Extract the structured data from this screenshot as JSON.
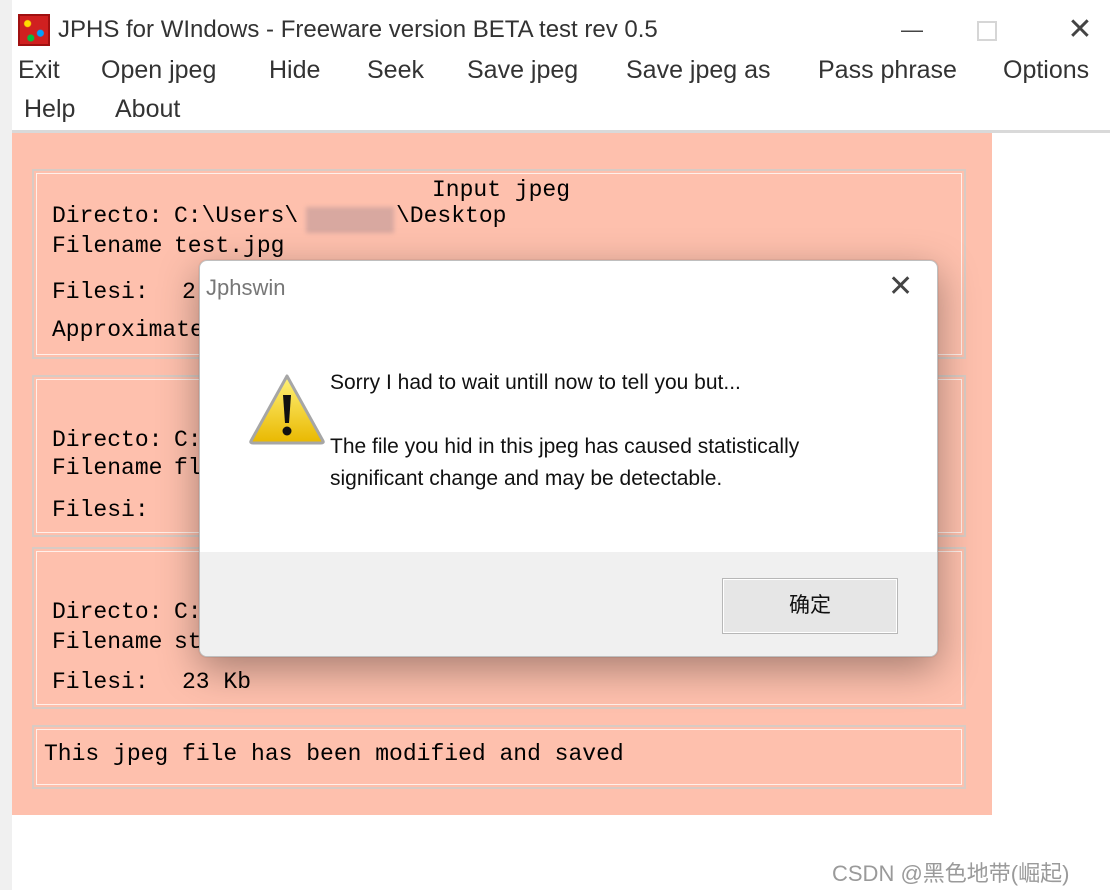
{
  "window": {
    "title": "JPHS for WIndows - Freeware version BETA test rev 0.5",
    "minimize": "—",
    "close": "✕"
  },
  "menu": {
    "exit": "Exit",
    "open_jpeg": "Open jpeg",
    "hide": "Hide",
    "seek": "Seek",
    "save_jpeg": "Save jpeg",
    "save_jpeg_as": "Save jpeg as",
    "pass_phrase": "Pass phrase",
    "options": "Options",
    "help": "Help",
    "about": "About"
  },
  "input_panel": {
    "header": "Input jpeg",
    "directory_label": "Directo:",
    "directory_prefix": "C:\\Users\\",
    "directory_suffix": "\\Desktop",
    "filename_label": "Filename",
    "filename_value": "test.jpg",
    "filesize_label": "Filesi:",
    "filesize_value": "2",
    "approx_label": "Approximate"
  },
  "hidden_panel": {
    "directory_label": "Directo:",
    "directory_value": "C:",
    "filename_label": "Filename",
    "filename_value": "fl",
    "filesize_label": "Filesi:"
  },
  "saved_panel": {
    "directory_label": "Directo:",
    "directory_value": "C:",
    "filename_label": "Filename",
    "filename_value": "st",
    "filesize_label": "Filesi:",
    "filesize_value": "23 Kb"
  },
  "status": {
    "text": "This jpeg file has been modified and saved"
  },
  "dialog": {
    "title": "Jphswin",
    "close": "✕",
    "line1": "Sorry I had to wait untill now to tell you but...",
    "line2": "The file you hid in this jpeg has caused statistically",
    "line3": "significant change and may be detectable.",
    "ok": "确定",
    "icon": "warning-icon"
  },
  "watermark": "CSDN @黑色地带(崛起)"
}
